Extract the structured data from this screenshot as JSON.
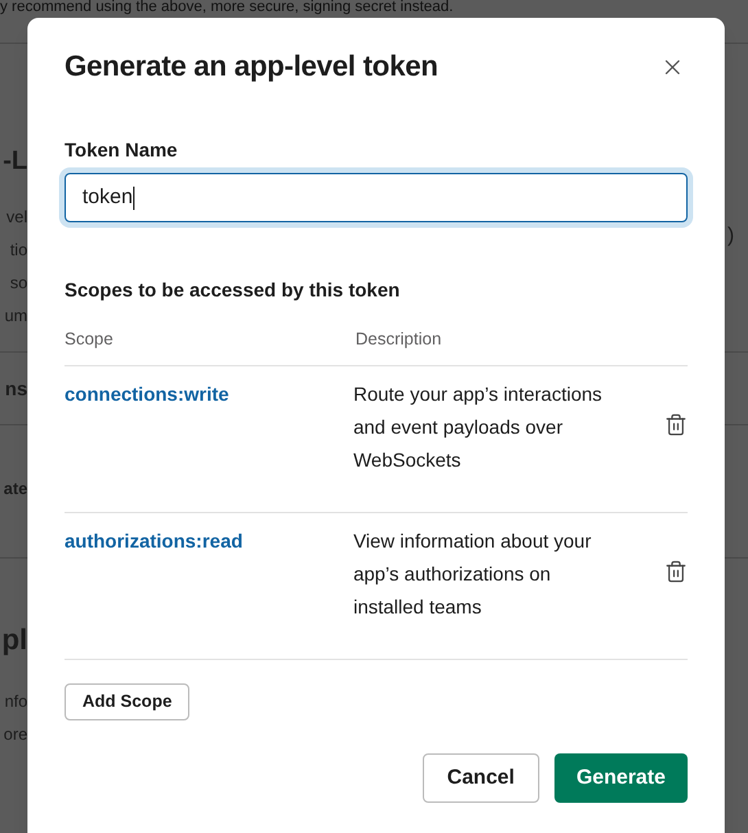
{
  "background": {
    "top_line": "y recommend using the above, more secure, signing secret instead.",
    "heading_1": "-L",
    "lines_1": [
      "vel",
      "tio",
      "so",
      "um"
    ],
    "heading_2": "ns",
    "button_fragment": "ate",
    "heading_3": "pl",
    "lines_2": [
      "nfo",
      "ore"
    ],
    "right_fragment": ")"
  },
  "dialog": {
    "title": "Generate an app-level token",
    "token_name": {
      "label": "Token Name",
      "value": "token"
    },
    "scopes": {
      "title": "Scopes to be accessed by this token",
      "columns": [
        "Scope",
        "Description"
      ],
      "rows": [
        {
          "scope": "connections:write",
          "description": "Route your app’s interactions and event payloads over WebSockets"
        },
        {
          "scope": "authorizations:read",
          "description": "View information about your app’s authorizations on installed teams"
        }
      ]
    },
    "add_button": "Add Scope",
    "buttons": [
      {
        "label": "Cancel",
        "kind": "secondary"
      },
      {
        "label": "Generate",
        "kind": "primary"
      }
    ]
  }
}
